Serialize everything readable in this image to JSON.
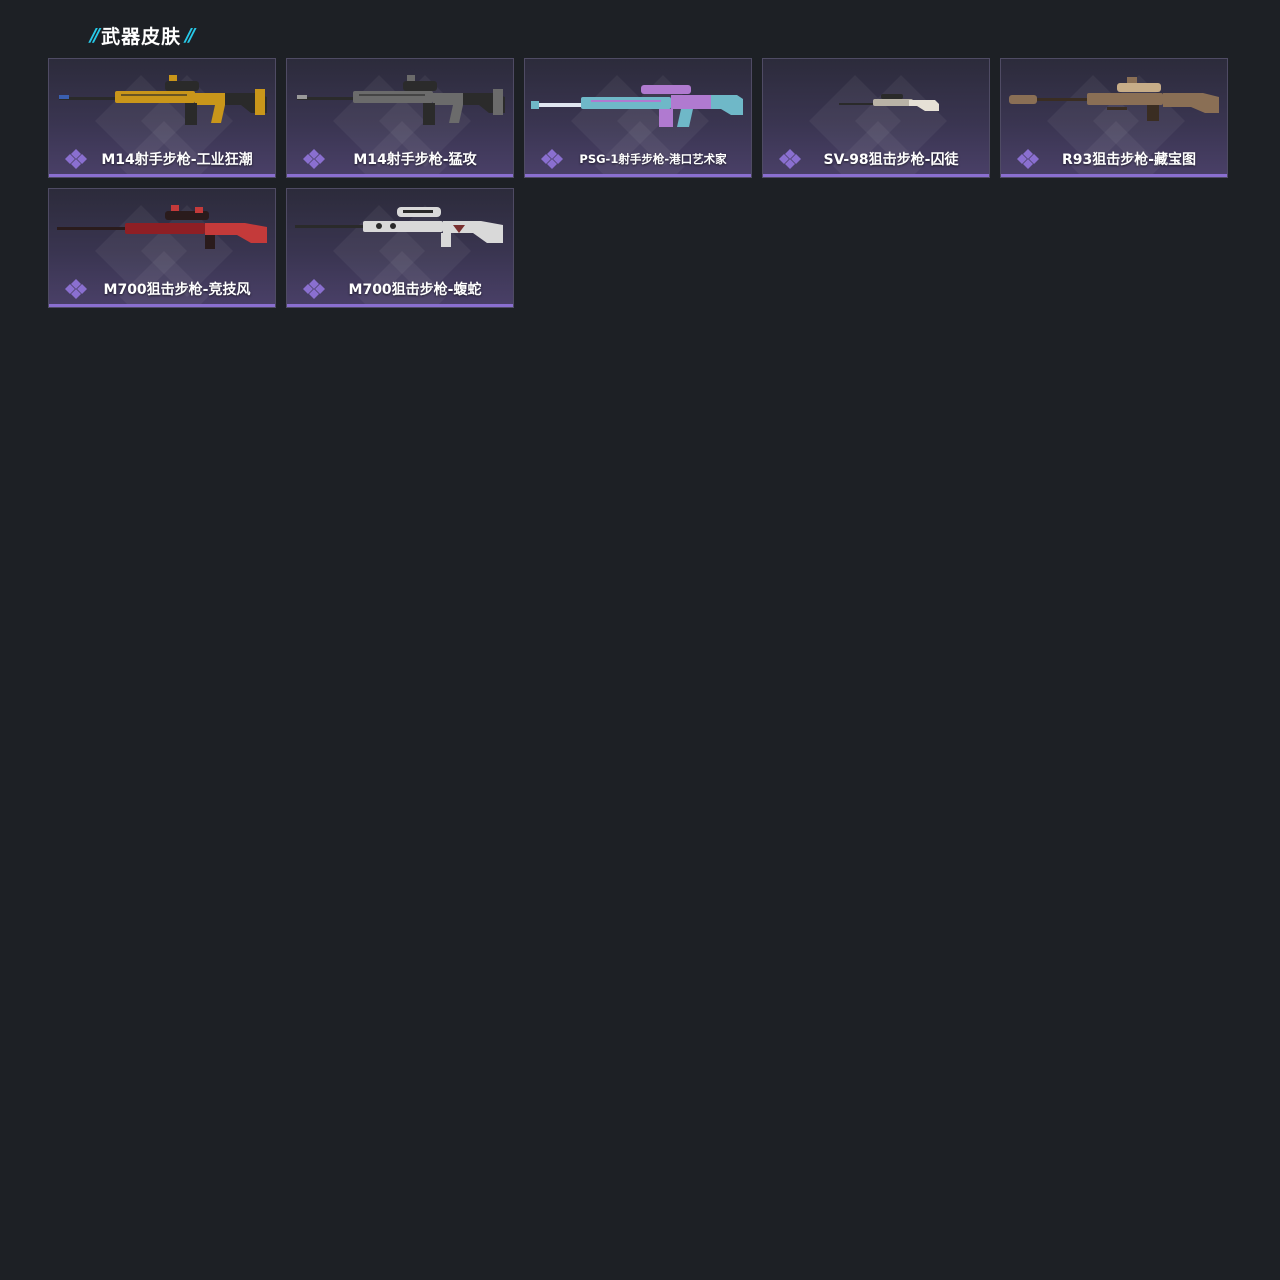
{
  "section": {
    "title": "武器皮肤",
    "slash_left": "//",
    "slash_right": "//"
  },
  "colors": {
    "background": "#1d2025",
    "accent_cyan": "#27c9e8",
    "rarity_purple": "#8a6fd0",
    "card_border": "#4f4b64"
  },
  "skins": [
    {
      "name": "M14射手步枪-工业狂潮",
      "weapon_type": "marksman-rifle",
      "primary_color": "#c9961a",
      "secondary_color": "#2a2a2a",
      "accent_color": "#3a5fb0",
      "icon": "m14-rifle-image"
    },
    {
      "name": "M14射手步枪-猛攻",
      "weapon_type": "marksman-rifle",
      "primary_color": "#6b6b6b",
      "secondary_color": "#2b2b2b",
      "accent_color": "#9a9a9a",
      "icon": "m14-rifle-image"
    },
    {
      "name": "PSG-1射手步枪-港口艺术家",
      "weapon_type": "marksman-rifle",
      "primary_color": "#6fb8c8",
      "secondary_color": "#b07ad0",
      "accent_color": "#e0e6f0",
      "icon": "psg1-rifle-image"
    },
    {
      "name": "SV-98狙击步枪-囚徒",
      "weapon_type": "sniper-rifle",
      "primary_color": "#b9b3a6",
      "secondary_color": "#2a2a2a",
      "accent_color": "#e6e1d6",
      "icon": "sv98-rifle-image"
    },
    {
      "name": "R93狙击步枪-藏宝图",
      "weapon_type": "sniper-rifle",
      "primary_color": "#8a6f55",
      "secondary_color": "#3a2d22",
      "accent_color": "#c7ad88",
      "icon": "r93-rifle-image"
    },
    {
      "name": "M700狙击步枪-竞技风",
      "weapon_type": "sniper-rifle",
      "primary_color": "#8e1f24",
      "secondary_color": "#2a1b1c",
      "accent_color": "#c43a3a",
      "icon": "m700-rifle-image"
    },
    {
      "name": "M700狙击步枪-蝮蛇",
      "weapon_type": "sniper-rifle",
      "primary_color": "#d9d9d9",
      "secondary_color": "#2a2a2a",
      "accent_color": "#7a3030",
      "icon": "m700-rifle-image"
    }
  ]
}
